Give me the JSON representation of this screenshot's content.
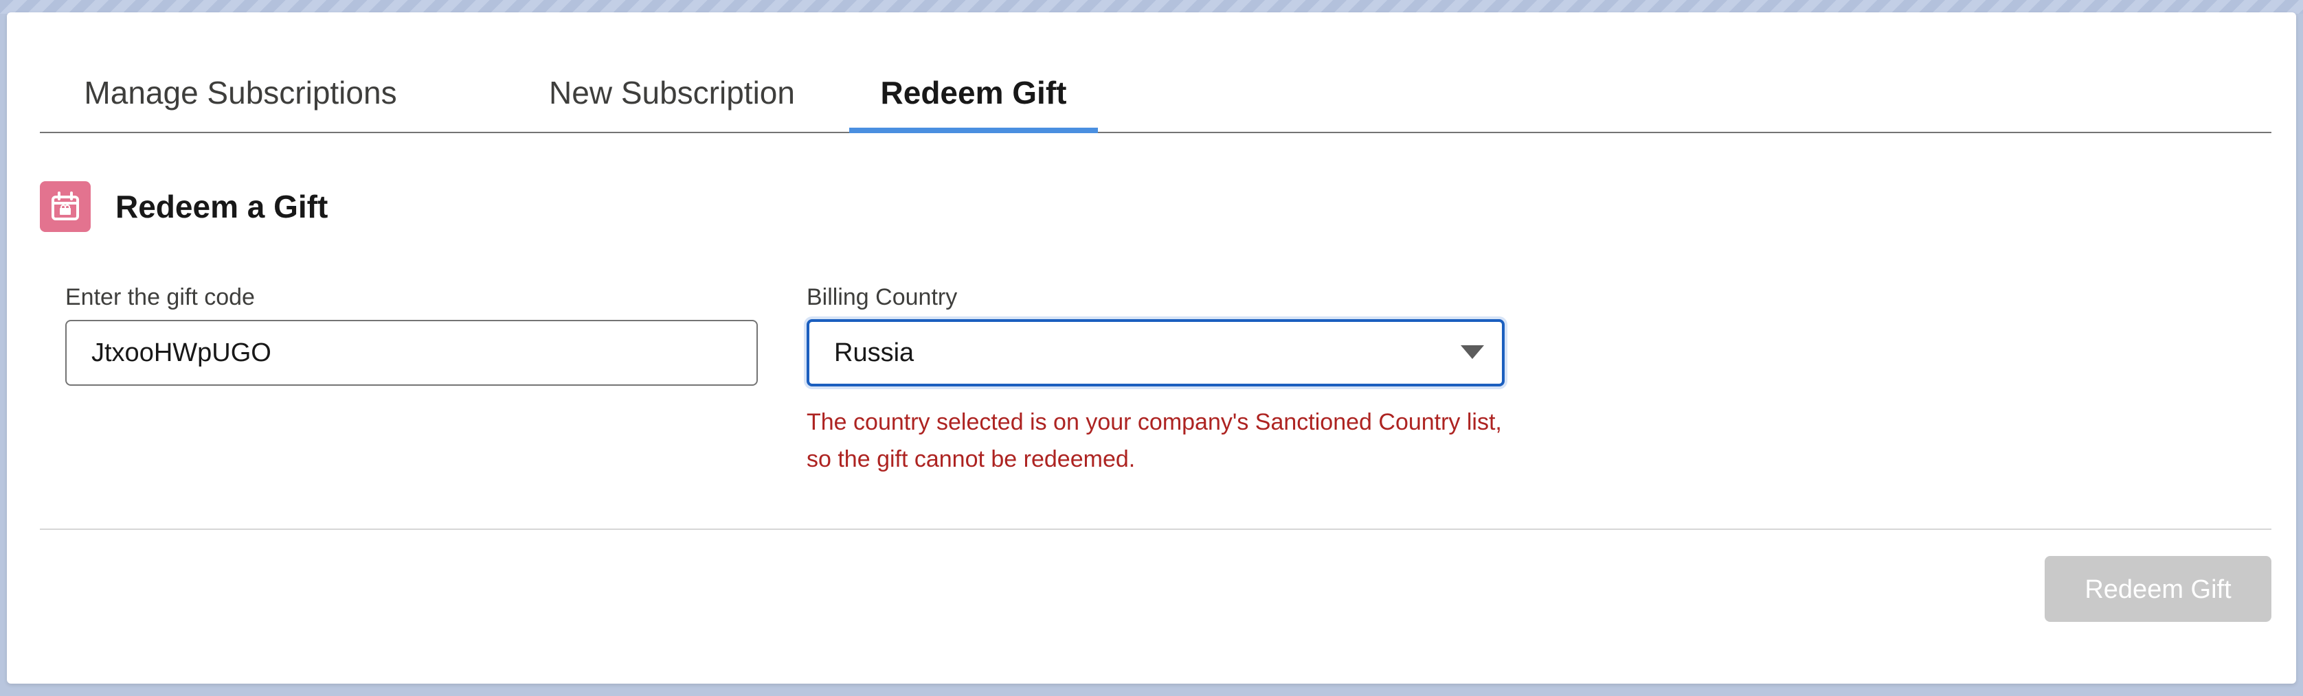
{
  "tabs": [
    {
      "label": "Manage Subscriptions",
      "active": false
    },
    {
      "label": "New Subscription",
      "active": false
    },
    {
      "label": "Redeem Gift",
      "active": true
    }
  ],
  "section": {
    "title": "Redeem a Gift",
    "icon": "gift-calendar-icon",
    "icon_color": "#e3738f"
  },
  "gift_code": {
    "label": "Enter the gift code",
    "value": "JtxooHWpUGO"
  },
  "billing_country": {
    "label": "Billing Country",
    "selected": "Russia",
    "error": "The country selected is on your company's Sanctioned Country list, so the gift cannot be redeemed."
  },
  "actions": {
    "redeem_label": "Redeem Gift",
    "disabled": true
  },
  "colors": {
    "accent": "#4a8fe0",
    "focus_border": "#1b5fbf",
    "error": "#ad2321",
    "button_disabled": "#c9c9c9"
  }
}
